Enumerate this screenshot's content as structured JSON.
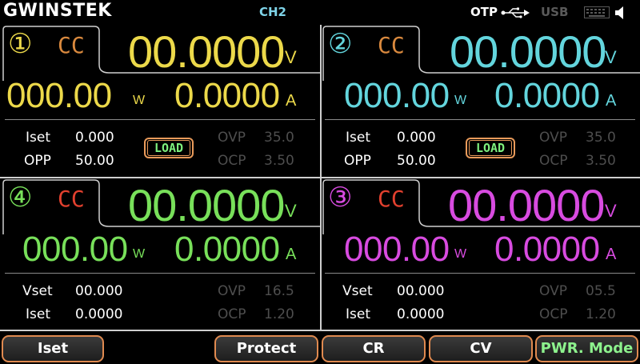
{
  "topbar": {
    "logo": "GWINSTEK",
    "channel": "CH2",
    "otp": "OTP",
    "usb": "USB"
  },
  "colors": {
    "ch1": "#ecd94a",
    "ch2": "#63d5dd",
    "ch3": "#d84be0",
    "ch4": "#78e05a",
    "cc_orange": "#d9893e",
    "cc_red": "#e2402e",
    "frame": "#cfcfcf",
    "softkey_border": "#e08a50"
  },
  "channels": [
    {
      "badge": "①",
      "mode": "CC",
      "voltage": "00.0000",
      "voltage_unit": "V",
      "power": "000.00",
      "power_unit": "W",
      "current": "0.0000",
      "current_unit": "A",
      "row1_label": "Iset",
      "row1_value": "0.000",
      "row2_label": "OPP",
      "row2_value": "50.00",
      "load": "LOAD",
      "p1_label": "OVP",
      "p1_value": "35.0",
      "p2_label": "OCP",
      "p2_value": "3.50"
    },
    {
      "badge": "②",
      "mode": "CC",
      "voltage": "00.0000",
      "voltage_unit": "V",
      "power": "000.00",
      "power_unit": "W",
      "current": "0.0000",
      "current_unit": "A",
      "row1_label": "Iset",
      "row1_value": "0.000",
      "row2_label": "OPP",
      "row2_value": "50.00",
      "load": "LOAD",
      "p1_label": "OVP",
      "p1_value": "35.0",
      "p2_label": "OCP",
      "p2_value": "3.50"
    },
    {
      "badge": "④",
      "mode": "CC",
      "voltage": "00.0000",
      "voltage_unit": "V",
      "power": "000.00",
      "power_unit": "W",
      "current": "0.0000",
      "current_unit": "A",
      "row1_label": "Vset",
      "row1_value": "00.000",
      "row2_label": "Iset",
      "row2_value": "0.0000",
      "p1_label": "OVP",
      "p1_value": "16.5",
      "p2_label": "OCP",
      "p2_value": "1.20"
    },
    {
      "badge": "③",
      "mode": "CC",
      "voltage": "00.0000",
      "voltage_unit": "V",
      "power": "000.00",
      "power_unit": "W",
      "current": "0.0000",
      "current_unit": "A",
      "row1_label": "Vset",
      "row1_value": "00.000",
      "row2_label": "Iset",
      "row2_value": "0.0000",
      "p1_label": "OVP",
      "p1_value": "05.5",
      "p2_label": "OCP",
      "p2_value": "1.20"
    }
  ],
  "softkeys": [
    "Iset",
    "Protect",
    "CR",
    "CV",
    "PWR. Mode"
  ],
  "icons": [
    "usb-icon",
    "keyboard-icon",
    "speaker-icon"
  ]
}
